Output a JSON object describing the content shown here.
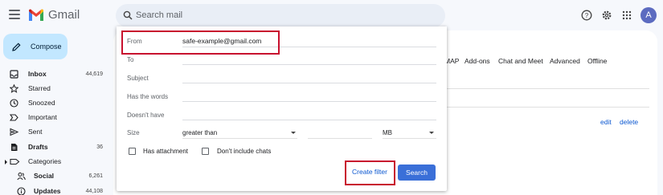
{
  "app": {
    "name": "Gmail",
    "avatar_initial": "A"
  },
  "search": {
    "placeholder": "Search mail"
  },
  "compose": {
    "label": "Compose"
  },
  "nav": [
    {
      "label": "Inbox",
      "count": "44,619",
      "bold": true,
      "icon": "inbox-icon"
    },
    {
      "label": "Starred",
      "count": "",
      "bold": false,
      "icon": "star-icon"
    },
    {
      "label": "Snoozed",
      "count": "",
      "bold": false,
      "icon": "clock-icon"
    },
    {
      "label": "Important",
      "count": "",
      "bold": false,
      "icon": "important-icon"
    },
    {
      "label": "Sent",
      "count": "",
      "bold": false,
      "icon": "send-icon"
    },
    {
      "label": "Drafts",
      "count": "36",
      "bold": true,
      "icon": "draft-icon"
    },
    {
      "label": "Categories",
      "count": "",
      "bold": false,
      "icon": "label-icon"
    },
    {
      "label": "Social",
      "count": "6,261",
      "bold": true,
      "icon": "people-icon"
    },
    {
      "label": "Updates",
      "count": "44,108",
      "bold": true,
      "icon": "info-icon"
    }
  ],
  "settings_tabs": [
    "MAP",
    "Add-ons",
    "Chat and Meet",
    "Advanced",
    "Offline"
  ],
  "row_links": {
    "edit": "edit",
    "delete": "delete"
  },
  "filter": {
    "from_label": "From",
    "from_value": "safe-example@gmail.com",
    "to_label": "To",
    "subject_label": "Subject",
    "has_words_label": "Has the words",
    "doesnt_have_label": "Doesn't have",
    "size_label": "Size",
    "size_comparator": "greater than",
    "size_unit": "MB",
    "has_attachment_label": "Has attachment",
    "no_chats_label": "Don't include chats",
    "create_filter_label": "Create filter",
    "search_label": "Search"
  },
  "colors": {
    "accent": "#3a6fd8",
    "highlight_box": "#c8102e",
    "compose_bg": "#c2e7ff"
  }
}
